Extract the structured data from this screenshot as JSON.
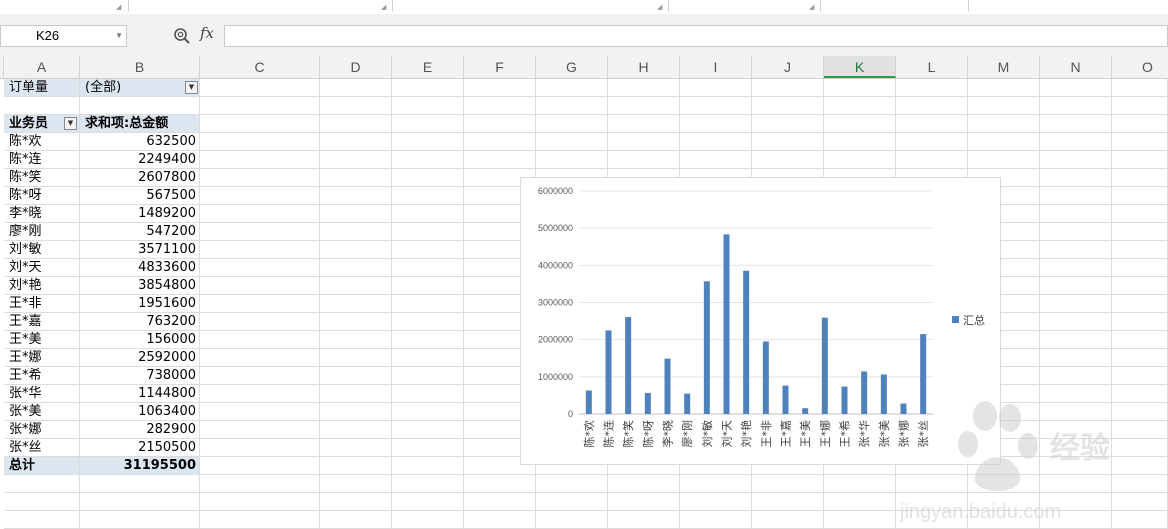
{
  "formula_bar": {
    "cell_ref": "K26",
    "formula": "",
    "fx_label": "fx"
  },
  "columns": [
    "A",
    "B",
    "C",
    "D",
    "E",
    "F",
    "G",
    "H",
    "I",
    "J",
    "K",
    "L",
    "M",
    "N",
    "O"
  ],
  "selected_column": "K",
  "pivot": {
    "filter_label": "订单量",
    "filter_value": "(全部)",
    "row_header": "业务员",
    "value_header": "求和项:总金额",
    "rows": [
      {
        "name": "陈*欢",
        "value": "632500"
      },
      {
        "name": "陈*连",
        "value": "2249400"
      },
      {
        "name": "陈*笑",
        "value": "2607800"
      },
      {
        "name": "陈*呀",
        "value": "567500"
      },
      {
        "name": "李*晓",
        "value": "1489200"
      },
      {
        "name": "廖*刚",
        "value": "547200"
      },
      {
        "name": "刘*敏",
        "value": "3571100"
      },
      {
        "name": "刘*天",
        "value": "4833600"
      },
      {
        "name": "刘*艳",
        "value": "3854800"
      },
      {
        "name": "王*非",
        "value": "1951600"
      },
      {
        "name": "王*嘉",
        "value": "763200"
      },
      {
        "name": "王*美",
        "value": "156000"
      },
      {
        "name": "王*娜",
        "value": "2592000"
      },
      {
        "name": "王*希",
        "value": "738000"
      },
      {
        "name": "张*华",
        "value": "1144800"
      },
      {
        "name": "张*美",
        "value": "1063400"
      },
      {
        "name": "张*娜",
        "value": "282900"
      },
      {
        "name": "张*丝",
        "value": "2150500"
      }
    ],
    "total_label": "总计",
    "total_value": "31195500"
  },
  "chart_data": {
    "type": "bar",
    "categories": [
      "陈*欢",
      "陈*连",
      "陈*笑",
      "陈*呀",
      "李*晓",
      "廖*刚",
      "刘*敏",
      "刘*天",
      "刘*艳",
      "王*非",
      "王*嘉",
      "王*美",
      "王*娜",
      "王*希",
      "张*华",
      "张*美",
      "张*娜",
      "张*丝"
    ],
    "series": [
      {
        "name": "汇总",
        "values": [
          632500,
          2249400,
          2607800,
          567500,
          1489200,
          547200,
          3571100,
          4833600,
          3854800,
          1951600,
          763200,
          156000,
          2592000,
          738000,
          1144800,
          1063400,
          282900,
          2150500
        ],
        "color": "#4f81bd"
      }
    ],
    "yticks": [
      "0",
      "1000000",
      "2000000",
      "3000000",
      "4000000",
      "5000000",
      "6000000"
    ],
    "ylim": [
      0,
      6000000
    ],
    "legend_position": "right",
    "grid": true
  },
  "watermark": {
    "text": "jingyan.baidu.com"
  },
  "colors": {
    "pivot_header": "#dce6f1",
    "bar": "#4f81bd",
    "selected_column": "#1a7a3c"
  }
}
